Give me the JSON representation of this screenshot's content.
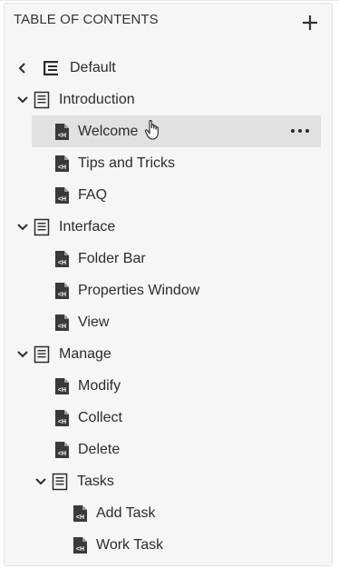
{
  "header": {
    "title": "TABLE OF CONTENTS",
    "add_icon": "plus-icon"
  },
  "tree": {
    "root": {
      "label": "Default",
      "icon": "toc-list-icon",
      "back_icon": "chevron-left-icon"
    },
    "items": [
      {
        "label": "Introduction",
        "type": "folder",
        "expanded": true
      },
      {
        "label": "Welcome",
        "type": "topic",
        "selected": true,
        "more_icon": "more-horizontal-icon"
      },
      {
        "label": "Tips and Tricks",
        "type": "topic"
      },
      {
        "label": "FAQ",
        "type": "topic"
      },
      {
        "label": "Interface",
        "type": "folder",
        "expanded": true
      },
      {
        "label": "Folder Bar",
        "type": "topic"
      },
      {
        "label": "Properties Window",
        "type": "topic"
      },
      {
        "label": "View",
        "type": "topic"
      },
      {
        "label": "Manage",
        "type": "folder",
        "expanded": true
      },
      {
        "label": "Modify",
        "type": "topic"
      },
      {
        "label": "Collect",
        "type": "topic"
      },
      {
        "label": "Delete",
        "type": "topic"
      },
      {
        "label": "Tasks",
        "type": "folder",
        "expanded": true
      },
      {
        "label": "Add Task",
        "type": "topic"
      },
      {
        "label": "Work Task",
        "type": "topic"
      }
    ]
  },
  "colors": {
    "panel_bg": "#f6f6f6",
    "selected_bg": "#e1e1e1",
    "text": "#2c2c2c",
    "icon": "#3a3a3a"
  }
}
